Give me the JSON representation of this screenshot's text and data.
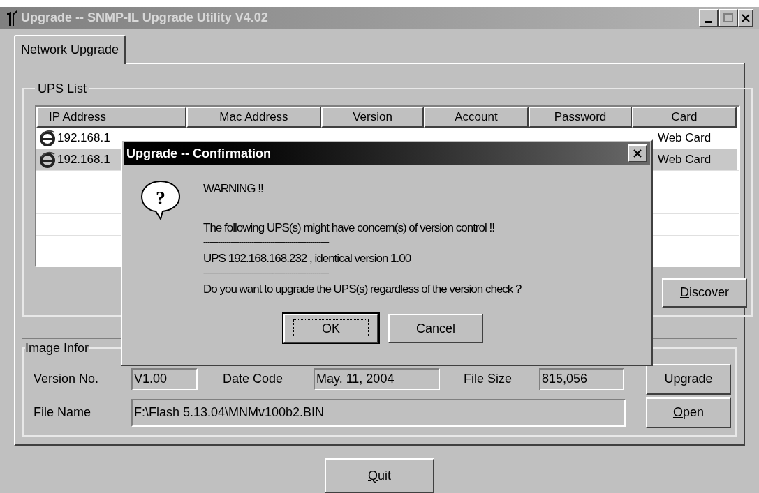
{
  "window": {
    "title": "Upgrade --  SNMP-IL Upgrade Utility V4.02"
  },
  "tabs": [
    {
      "label": "Network Upgrade",
      "selected": true
    }
  ],
  "ups_list": {
    "title": "UPS List",
    "columns": [
      "IP Address",
      "Mac Address",
      "Version",
      "Account",
      "Password",
      "Card"
    ],
    "rows": [
      {
        "ip": "192.168.1",
        "card": "Web Card",
        "selected": false
      },
      {
        "ip": "192.168.1",
        "card": "Web Card",
        "selected": true
      }
    ]
  },
  "discover_button": {
    "label": "Discover"
  },
  "image_info": {
    "title": "Image Infor",
    "version_no": {
      "label": "Version No.",
      "value": "V1.00"
    },
    "date_code": {
      "label": "Date Code",
      "value": "May. 11, 2004"
    },
    "file_size": {
      "label": "File Size",
      "value": "815,056"
    },
    "file_name": {
      "label": "File Name",
      "value": "F:\\Flash 5.13.04\\MNMv100b2.BIN"
    },
    "upgrade_button": {
      "label": "Upgrade"
    },
    "open_button": {
      "label": "Open"
    }
  },
  "quit_button": {
    "label": "Quit"
  },
  "dialog": {
    "title": "Upgrade -- Confirmation",
    "icon_glyph": "?",
    "lines": [
      "WARNING !!",
      "The following UPS(s) might have concern(s) of version control !!",
      "------------------------------------------------------------",
      "UPS 192.168.168.232 , identical version 1.00",
      "------------------------------------------------------------",
      "Do you want to upgrade the UPS(s) regardless of the version check ?"
    ],
    "buttons": [
      {
        "label": "OK",
        "focused": true
      },
      {
        "label": "Cancel",
        "focused": false
      }
    ]
  }
}
